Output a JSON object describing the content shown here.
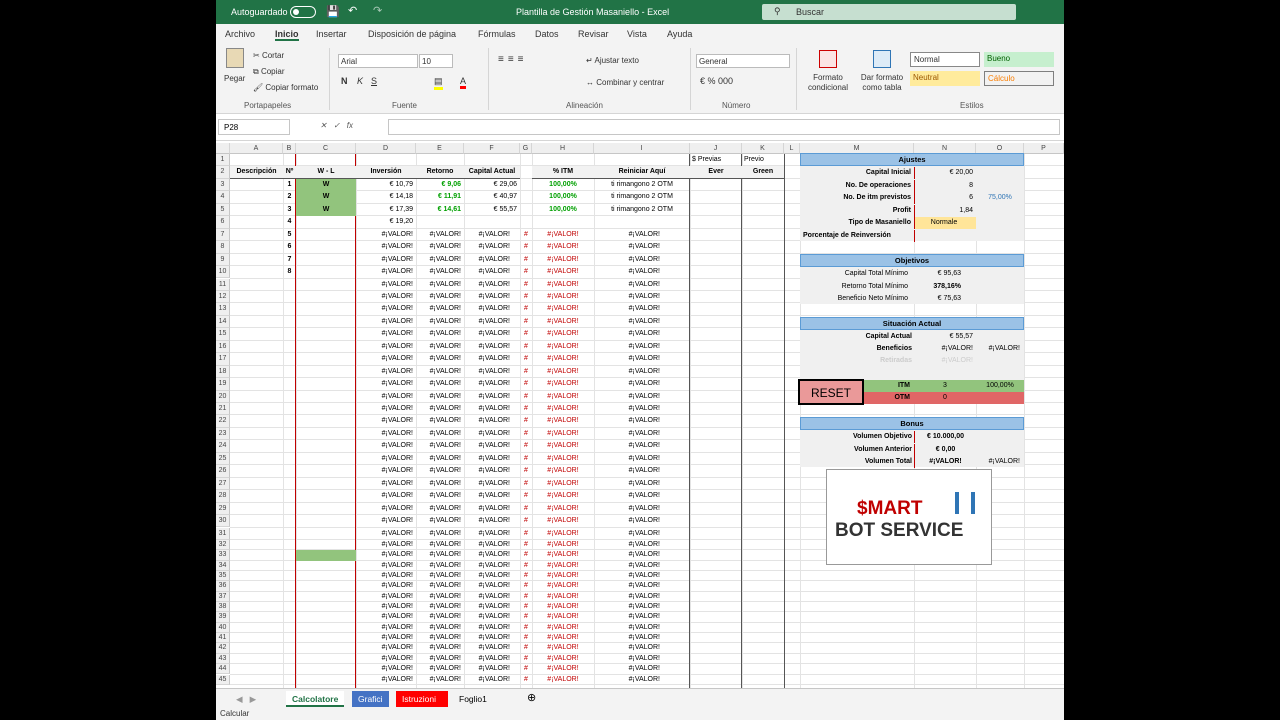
{
  "titlebar": {
    "autosave": "Autoguardado",
    "title": "Plantilla de Gestión Masaniello  -  Excel",
    "search": "Buscar"
  },
  "tabs": [
    "Archivo",
    "Inicio",
    "Insertar",
    "Disposición de página",
    "Fórmulas",
    "Datos",
    "Revisar",
    "Vista",
    "Ayuda"
  ],
  "ribbon": {
    "paste": "Pegar",
    "cut": "Cortar",
    "copy": "Copiar",
    "copyformat": "Copiar formato",
    "clipboard": "Portapapeles",
    "font": "Arial",
    "size": "10",
    "fontgroup": "Fuente",
    "wrap": "Ajustar texto",
    "merge": "Combinar y centrar",
    "align": "Alineación",
    "numfmt": "General",
    "numgroup": "Número",
    "condfmt": "Formato condicional",
    "tablefmt": "Dar formato como tabla",
    "styles": "Estilos",
    "normal": "Normal",
    "good": "Bueno",
    "neutral": "Neutral",
    "calc": "Cálculo"
  },
  "namebox": "P28",
  "columns": [
    "A",
    "B",
    "C",
    "D",
    "E",
    "F",
    "G",
    "H",
    "I",
    "J",
    "K",
    "L",
    "M",
    "N",
    "O",
    "P"
  ],
  "row1": {
    "j": "$ Previas",
    "k": "Previo"
  },
  "headers": {
    "a": "Descripción",
    "b": "Nº",
    "c": "W - L",
    "d": "Inversión",
    "e": "Retorno",
    "f": "Capital Actual",
    "h": "% ITM",
    "i": "Reiniciar Aquí",
    "j": "Ever",
    "k": "Green"
  },
  "rows": [
    {
      "n": "1",
      "wl": "W",
      "inv": "€ 10,79",
      "ret": "€ 9,06",
      "cap": "€ 29,06",
      "pct": "100,00%",
      "rein": "ti rimangono 2 OTM"
    },
    {
      "n": "2",
      "wl": "W",
      "inv": "€ 14,18",
      "ret": "€ 11,91",
      "cap": "€ 40,97",
      "pct": "100,00%",
      "rein": "ti rimangono 2 OTM"
    },
    {
      "n": "3",
      "wl": "W",
      "inv": "€ 17,39",
      "ret": "€ 14,61",
      "cap": "€ 55,57",
      "pct": "100,00%",
      "rein": "ti rimangono 2 OTM"
    },
    {
      "n": "4",
      "wl": "",
      "inv": "€ 19,20",
      "ret": "",
      "cap": "",
      "pct": "",
      "rein": ""
    }
  ],
  "error": "#¡VALOR!",
  "hash": "#",
  "ajustes": {
    "title": "Ajustes",
    "rows": [
      [
        "Capital Inicial",
        "€ 20,00",
        ""
      ],
      [
        "No. De operaciones",
        "8",
        ""
      ],
      [
        "No. De itm previstos",
        "6",
        "75,00%"
      ],
      [
        "Profit",
        "1,84",
        ""
      ],
      [
        "Tipo de Masaniello",
        "Normale",
        ""
      ],
      [
        "Porcentaje de Reinversión",
        "",
        ""
      ]
    ]
  },
  "objetivos": {
    "title": "Objetivos",
    "rows": [
      [
        "Capital Total Mínimo",
        "€ 95,63"
      ],
      [
        "Retorno Total Mínimo",
        "378,16%"
      ],
      [
        "Beneficio Neto Mínimo",
        "€ 75,63"
      ]
    ]
  },
  "situacion": {
    "title": "Situación Actual",
    "capital": "Capital Actual",
    "capital_v": "€ 55,57",
    "benef": "Beneficios",
    "retir": "Retiradas",
    "reset": "RESET",
    "itm": "ITM",
    "itm_v": "3",
    "itm_p": "100,00%",
    "otm": "OTM",
    "otm_v": "0"
  },
  "bonus": {
    "title": "Bonus",
    "rows": [
      [
        "Volumen Objetivo",
        "€ 10.000,00"
      ],
      [
        "Volumen Anterior",
        "€ 0,00"
      ],
      [
        "Volumen Total",
        "#¡VALOR!"
      ]
    ]
  },
  "logo": {
    "l1": "$MART",
    "l2": "BOT SERVICE"
  },
  "sheets": [
    "Calcolatore",
    "Grafici",
    "Istruzioni",
    "Foglio1"
  ],
  "status": "Calcular",
  "colors": {
    "excel": "#217346",
    "green": "#92c47d",
    "blue": "#9bc2e6",
    "red": "#e06666"
  }
}
